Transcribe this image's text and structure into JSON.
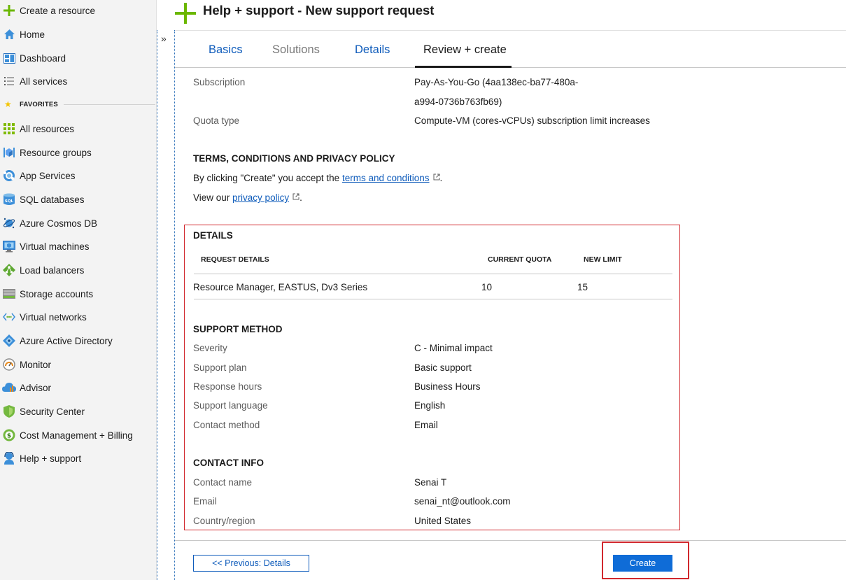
{
  "sidebar": {
    "create": "Create a resource",
    "home": "Home",
    "dashboard": "Dashboard",
    "all_services": "All services",
    "favorites_label": "FAVORITES",
    "favorites": [
      {
        "label": "All resources",
        "icon": "all-resources-icon"
      },
      {
        "label": "Resource groups",
        "icon": "resource-groups-icon"
      },
      {
        "label": "App Services",
        "icon": "app-services-icon"
      },
      {
        "label": "SQL databases",
        "icon": "sql-databases-icon"
      },
      {
        "label": "Azure Cosmos DB",
        "icon": "cosmos-db-icon"
      },
      {
        "label": "Virtual machines",
        "icon": "virtual-machines-icon"
      },
      {
        "label": "Load balancers",
        "icon": "load-balancers-icon"
      },
      {
        "label": "Storage accounts",
        "icon": "storage-accounts-icon"
      },
      {
        "label": "Virtual networks",
        "icon": "virtual-networks-icon"
      },
      {
        "label": "Azure Active Directory",
        "icon": "active-directory-icon"
      },
      {
        "label": "Monitor",
        "icon": "monitor-icon"
      },
      {
        "label": "Advisor",
        "icon": "advisor-icon"
      },
      {
        "label": "Security Center",
        "icon": "security-center-icon"
      },
      {
        "label": "Cost Management + Billing",
        "icon": "cost-management-icon"
      },
      {
        "label": "Help + support",
        "icon": "help-support-icon"
      }
    ]
  },
  "collapse_glyph": "»",
  "header": {
    "title": "Help + support - New support request"
  },
  "tabs": [
    "Basics",
    "Solutions",
    "Details",
    "Review + create"
  ],
  "summary": {
    "subscription_label": "Subscription",
    "subscription_value_line1": "Pay-As-You-Go (4aa138ec-ba77-480a-",
    "subscription_value_line2": "a994-0736b763fb69)",
    "quota_type_label": "Quota type",
    "quota_type_value": "Compute-VM (cores-vCPUs) subscription limit increases"
  },
  "terms": {
    "title": "TERMS, CONDITIONS AND PRIVACY POLICY",
    "line1_prefix": "By clicking \"Create\" you accept the",
    "line1_link": "terms and conditions",
    "line1_suffix": ".",
    "line2_prefix": "View our",
    "line2_link": "privacy policy",
    "line2_suffix": "."
  },
  "details": {
    "title": "DETAILS",
    "headers": [
      "REQUEST DETAILS",
      "CURRENT QUOTA",
      "NEW LIMIT"
    ],
    "row": [
      "Resource Manager, EASTUS, Dv3 Series",
      "10",
      "15"
    ]
  },
  "support_method": {
    "title": "SUPPORT METHOD",
    "severity_label": "Severity",
    "severity_value": "C - Minimal impact",
    "plan_label": "Support plan",
    "plan_value": "Basic support",
    "hours_label": "Response hours",
    "hours_value": "Business Hours",
    "language_label": "Support language",
    "language_value": "English",
    "contact_method_label": "Contact method",
    "contact_method_value": "Email"
  },
  "contact_info": {
    "title": "CONTACT INFO",
    "name_label": "Contact name",
    "name_value": "Senai T",
    "email_label": "Email",
    "email_value": "senai_nt@outlook.com",
    "country_label": "Country/region",
    "country_value": "United States"
  },
  "footer": {
    "prev_label": "<< Previous: Details",
    "create_label": "Create"
  },
  "colors": {
    "accent": "#0f5cbb",
    "highlight": "#d1282d",
    "create_button": "#0f6cd7",
    "plus_green": "#6bb700"
  }
}
